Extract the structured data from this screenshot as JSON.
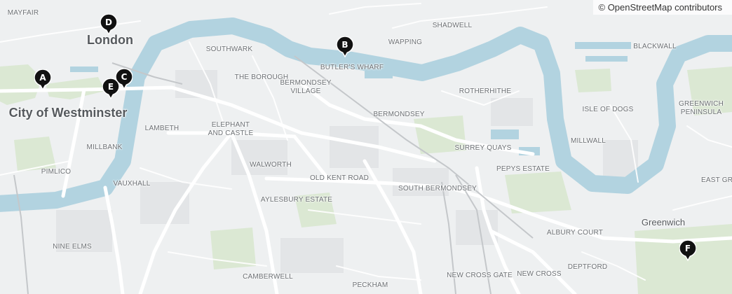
{
  "attribution": "© OpenStreetMap contributors",
  "place_labels": [
    {
      "id": "mayfair",
      "text": "MAYFAIR",
      "style": "small"
    },
    {
      "id": "london",
      "text": "London",
      "style": "big"
    },
    {
      "id": "city-of-westminster",
      "text": "City of Westminster",
      "style": "big"
    },
    {
      "id": "southwark",
      "text": "SOUTHWARK",
      "style": "small"
    },
    {
      "id": "the-borough",
      "text": "THE BOROUGH",
      "style": "small"
    },
    {
      "id": "butlers-wharf",
      "text": "BUTLER'S WHARF",
      "style": "small"
    },
    {
      "id": "shadwell",
      "text": "SHADWELL",
      "style": "small"
    },
    {
      "id": "wapping",
      "text": "WAPPING",
      "style": "small"
    },
    {
      "id": "blackwall",
      "text": "BLACKWALL",
      "style": "small"
    },
    {
      "id": "bermondsey-village",
      "text": "BERMONDSEY\nVILLAGE",
      "style": "small"
    },
    {
      "id": "rotherhithe",
      "text": "ROTHERHITHE",
      "style": "small"
    },
    {
      "id": "bermondsey",
      "text": "BERMONDSEY",
      "style": "small"
    },
    {
      "id": "isle-of-dogs",
      "text": "ISLE OF DOGS",
      "style": "small"
    },
    {
      "id": "greenwich-peninsula",
      "text": "GREENWICH\nPENINSULA",
      "style": "small"
    },
    {
      "id": "lambeth",
      "text": "LAMBETH",
      "style": "small"
    },
    {
      "id": "elephant-and-castle",
      "text": "ELEPHANT\nAND CASTLE",
      "style": "small"
    },
    {
      "id": "millbank",
      "text": "MILLBANK",
      "style": "small"
    },
    {
      "id": "surrey-quays",
      "text": "SURREY QUAYS",
      "style": "small"
    },
    {
      "id": "millwall",
      "text": "MILLWALL",
      "style": "small"
    },
    {
      "id": "walworth",
      "text": "WALWORTH",
      "style": "small"
    },
    {
      "id": "pimlico",
      "text": "PIMLICO",
      "style": "small"
    },
    {
      "id": "pepys-estate",
      "text": "PEPYS ESTATE",
      "style": "small"
    },
    {
      "id": "old-kent-road",
      "text": "OLD KENT ROAD",
      "style": "small"
    },
    {
      "id": "east-greenwich",
      "text": "EAST GRE",
      "style": "small"
    },
    {
      "id": "vauxhall",
      "text": "VAUXHALL",
      "style": "small"
    },
    {
      "id": "aylesbury-estate",
      "text": "AYLESBURY ESTATE",
      "style": "small"
    },
    {
      "id": "south-bermondsey",
      "text": "SOUTH BERMONDSEY",
      "style": "small"
    },
    {
      "id": "greenwich",
      "text": "Greenwich",
      "style": "mid"
    },
    {
      "id": "albury-court",
      "text": "ALBURY COURT",
      "style": "small"
    },
    {
      "id": "nine-elms",
      "text": "NINE ELMS",
      "style": "small"
    },
    {
      "id": "deptford",
      "text": "DEPTFORD",
      "style": "small"
    },
    {
      "id": "new-cross-gate",
      "text": "NEW CROSS GATE",
      "style": "small"
    },
    {
      "id": "new-cross",
      "text": "NEW CROSS",
      "style": "small"
    },
    {
      "id": "camberwell",
      "text": "CAMBERWELL",
      "style": "small"
    },
    {
      "id": "peckham",
      "text": "PECKHAM",
      "style": "small"
    }
  ],
  "markers": [
    {
      "id": "a",
      "label": "A"
    },
    {
      "id": "b",
      "label": "B"
    },
    {
      "id": "c",
      "label": "C"
    },
    {
      "id": "d",
      "label": "D"
    },
    {
      "id": "e",
      "label": "E"
    },
    {
      "id": "f",
      "label": "F"
    }
  ],
  "colors": {
    "land": "#eef0f1",
    "water": "#b2d3e0",
    "park": "#dbe8d3",
    "road": "#ffffff",
    "marker": "#111111"
  }
}
